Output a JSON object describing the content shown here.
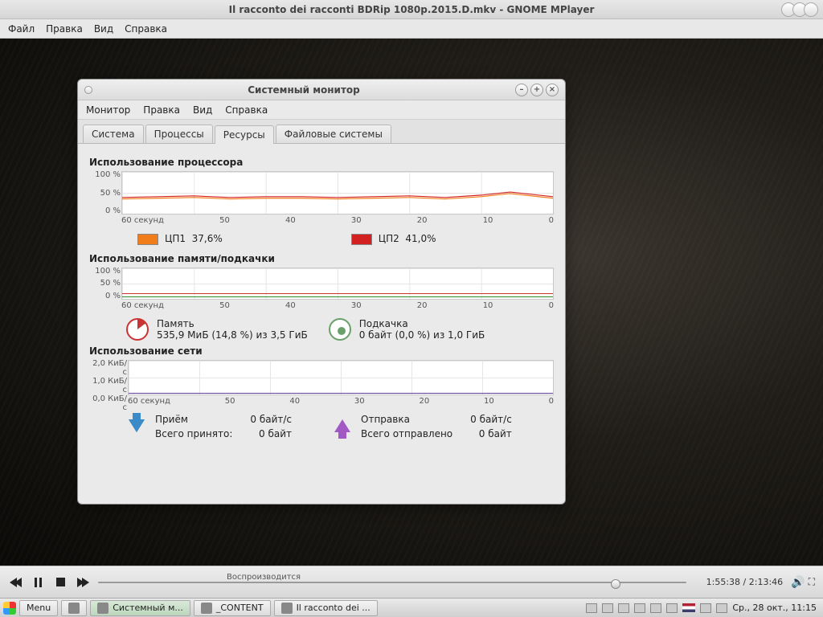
{
  "mplayer": {
    "title": "Il racconto dei racconti BDRip 1080p.2015.D.mkv - GNOME MPlayer",
    "menu": [
      "Файл",
      "Правка",
      "Вид",
      "Справка"
    ],
    "status": "Воспроизводится",
    "time": "1:55:38 / 2:13:46",
    "progress_pct": 88
  },
  "sysmon": {
    "title": "Системный монитор",
    "menu": [
      "Монитор",
      "Правка",
      "Вид",
      "Справка"
    ],
    "tabs": [
      "Система",
      "Процессы",
      "Ресурсы",
      "Файловые системы"
    ],
    "active_tab": 2,
    "cpu": {
      "title": "Использование процессора",
      "ylabels": [
        "100 %",
        "50 %",
        "0 %"
      ],
      "xlabels": [
        "60 секунд",
        "50",
        "40",
        "30",
        "20",
        "10",
        "0"
      ],
      "legend": [
        {
          "label": "ЦП1",
          "value": "37,6%",
          "color": "#f07d1a"
        },
        {
          "label": "ЦП2",
          "value": "41,0%",
          "color": "#d32121"
        }
      ]
    },
    "mem": {
      "title": "Использование памяти/подкачки",
      "ylabels": [
        "100 %",
        "50 %",
        "0 %"
      ],
      "xlabels": [
        "60 секунд",
        "50",
        "40",
        "30",
        "20",
        "10",
        "0"
      ],
      "memory": {
        "name": "Память",
        "text": "535,9 МиБ (14,8 %) из 3,5 ГиБ"
      },
      "swap": {
        "name": "Подкачка",
        "text": "0 байт (0,0 %) из 1,0 ГиБ"
      }
    },
    "net": {
      "title": "Использование сети",
      "ylabels": [
        "2,0 КиБ/с",
        "1,0 КиБ/с",
        "0,0 КиБ/с"
      ],
      "xlabels": [
        "60 секунд",
        "50",
        "40",
        "30",
        "20",
        "10",
        "0"
      ],
      "rx": {
        "name": "Приём",
        "rate": "0 байт/с",
        "total_label": "Всего принято:",
        "total": "0 байт"
      },
      "tx": {
        "name": "Отправка",
        "rate": "0 байт/с",
        "total_label": "Всего отправлено",
        "total": "0 байт"
      }
    }
  },
  "taskbar": {
    "menu": "Menu",
    "apps": [
      {
        "label": "Системный м..."
      },
      {
        "label": "_CONTENT"
      },
      {
        "label": "Il racconto dei ..."
      }
    ],
    "clock": "Ср., 28 окт., 11:15"
  },
  "chart_data": [
    {
      "type": "line",
      "title": "Использование процессора",
      "xlabel": "секунд",
      "ylabel": "%",
      "xlim": [
        0,
        60
      ],
      "ylim": [
        0,
        100
      ],
      "x": [
        60,
        55,
        50,
        45,
        40,
        35,
        30,
        25,
        20,
        15,
        10,
        5,
        0
      ],
      "series": [
        {
          "name": "ЦП1",
          "color": "#f07d1a",
          "values": [
            38,
            37,
            39,
            36,
            38,
            37,
            38,
            36,
            39,
            37,
            40,
            45,
            38
          ]
        },
        {
          "name": "ЦП2",
          "color": "#d32121",
          "values": [
            40,
            41,
            42,
            39,
            41,
            40,
            41,
            39,
            42,
            40,
            43,
            48,
            41
          ]
        }
      ]
    },
    {
      "type": "line",
      "title": "Использование памяти/подкачки",
      "xlabel": "секунд",
      "ylabel": "%",
      "xlim": [
        0,
        60
      ],
      "ylim": [
        0,
        100
      ],
      "x": [
        60,
        0
      ],
      "series": [
        {
          "name": "Память",
          "color": "#d32121",
          "values": [
            14.8,
            14.8
          ]
        },
        {
          "name": "Подкачка",
          "color": "#2a8a2a",
          "values": [
            0,
            0
          ]
        }
      ]
    },
    {
      "type": "line",
      "title": "Использование сети",
      "xlabel": "секунд",
      "ylabel": "КиБ/с",
      "xlim": [
        0,
        60
      ],
      "ylim": [
        0,
        2
      ],
      "x": [
        60,
        0
      ],
      "series": [
        {
          "name": "Приём",
          "color": "#3a8bc8",
          "values": [
            0,
            0
          ]
        },
        {
          "name": "Отправка",
          "color": "#a259c4",
          "values": [
            0,
            0
          ]
        }
      ]
    }
  ]
}
